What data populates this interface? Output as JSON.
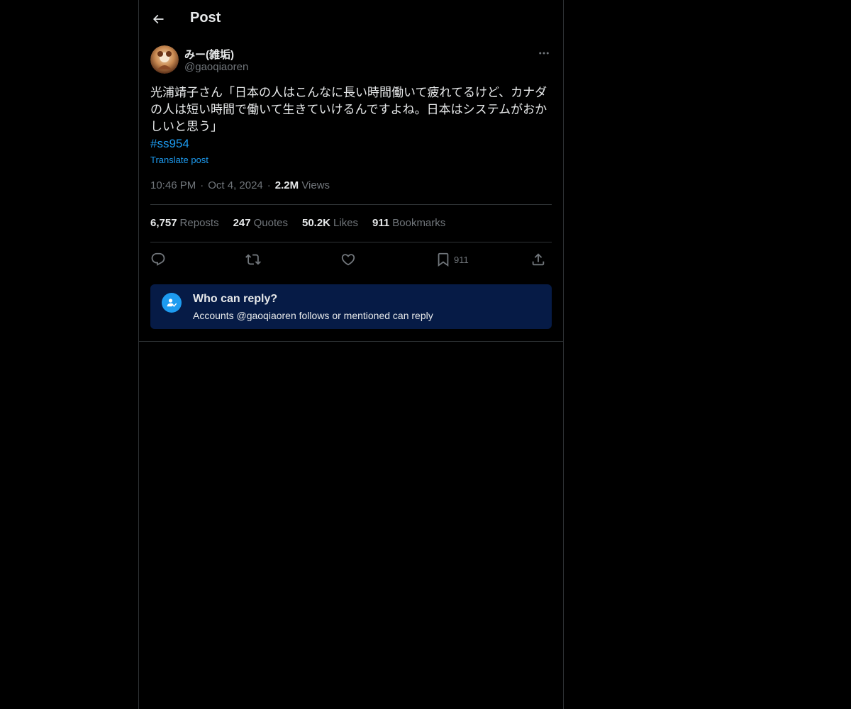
{
  "header": {
    "title": "Post",
    "back_icon": "arrow-left-icon"
  },
  "author": {
    "display_name": "みー(雑垢)",
    "handle": "@gaoqiaoren"
  },
  "post": {
    "text": "光浦靖子さん「日本の人はこんなに長い時間働いて疲れてるけど、カナダの人は短い時間で働いて生きていけるんですよね。日本はシステムがおかしいと思う」",
    "hashtag": "#ss954",
    "translate_label": "Translate post",
    "time": "10:46 PM",
    "date": "Oct 4, 2024",
    "views_count": "2.2M",
    "views_label": "Views"
  },
  "stats": [
    {
      "count": "6,757",
      "label": "Reposts"
    },
    {
      "count": "247",
      "label": "Quotes"
    },
    {
      "count": "50.2K",
      "label": "Likes"
    },
    {
      "count": "911",
      "label": "Bookmarks"
    }
  ],
  "actions": {
    "reply_icon": "reply-icon",
    "repost_icon": "repost-icon",
    "like_icon": "heart-icon",
    "bookmark_icon": "bookmark-icon",
    "bookmark_count": "911",
    "share_icon": "share-icon"
  },
  "reply_restriction": {
    "title": "Who can reply?",
    "subtitle": "Accounts @gaoqiaoren follows or mentioned can reply"
  },
  "colors": {
    "background": "#000000",
    "text": "#e7e9ea",
    "muted": "#71767b",
    "accent": "#1d9bf0",
    "border": "#2f3336",
    "reply_box": "#061b46"
  }
}
